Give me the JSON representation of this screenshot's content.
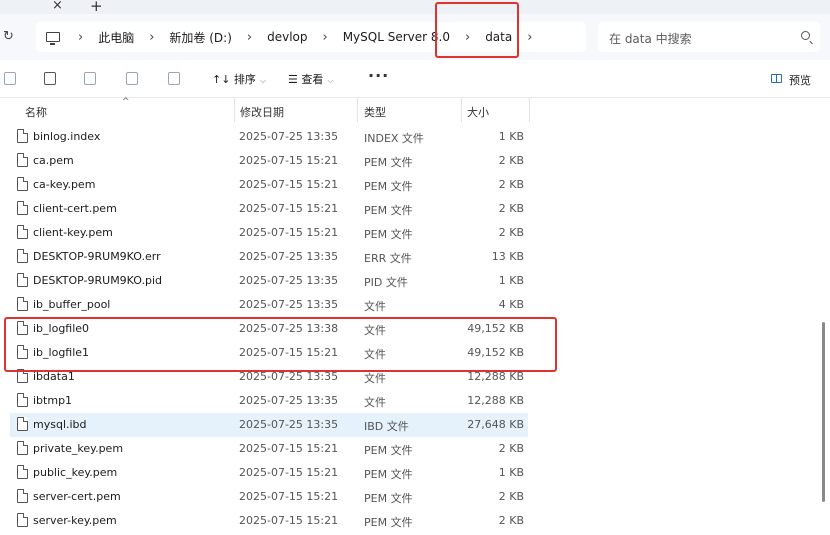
{
  "window": {
    "tab_close": "×",
    "tab_new": "+"
  },
  "address": {
    "refresh_icon": "refresh-icon",
    "crumbs": [
      "此电脑",
      "新加卷 (D:)",
      "devlop",
      "MySQL Server 8.0",
      "data"
    ],
    "separator": "›"
  },
  "search": {
    "placeholder": "在 data 中搜索"
  },
  "toolbar": {
    "sort_label": "↑↓ 排序",
    "view_label": "☰ 查看",
    "more_label": "···",
    "preview_label": "预览"
  },
  "columns": {
    "name": "名称",
    "date": "修改日期",
    "type": "类型",
    "size": "大小",
    "sort_caret": "^"
  },
  "files": [
    {
      "name": "binlog.index",
      "date": "2025-07-25 13:35",
      "type": "INDEX 文件",
      "size": "1 KB"
    },
    {
      "name": "ca.pem",
      "date": "2025-07-15 15:21",
      "type": "PEM 文件",
      "size": "2 KB"
    },
    {
      "name": "ca-key.pem",
      "date": "2025-07-15 15:21",
      "type": "PEM 文件",
      "size": "2 KB"
    },
    {
      "name": "client-cert.pem",
      "date": "2025-07-15 15:21",
      "type": "PEM 文件",
      "size": "2 KB"
    },
    {
      "name": "client-key.pem",
      "date": "2025-07-15 15:21",
      "type": "PEM 文件",
      "size": "2 KB"
    },
    {
      "name": "DESKTOP-9RUM9KO.err",
      "date": "2025-07-25 13:35",
      "type": "ERR 文件",
      "size": "13 KB"
    },
    {
      "name": "DESKTOP-9RUM9KO.pid",
      "date": "2025-07-25 13:35",
      "type": "PID 文件",
      "size": "1 KB"
    },
    {
      "name": "ib_buffer_pool",
      "date": "2025-07-25 13:35",
      "type": "文件",
      "size": "4 KB"
    },
    {
      "name": "ib_logfile0",
      "date": "2025-07-25 13:38",
      "type": "文件",
      "size": "49,152 KB"
    },
    {
      "name": "ib_logfile1",
      "date": "2025-07-15 15:21",
      "type": "文件",
      "size": "49,152 KB"
    },
    {
      "name": "ibdata1",
      "date": "2025-07-25 13:35",
      "type": "文件",
      "size": "12,288 KB"
    },
    {
      "name": "ibtmp1",
      "date": "2025-07-25 13:35",
      "type": "文件",
      "size": "12,288 KB"
    },
    {
      "name": "mysql.ibd",
      "date": "2025-07-25 13:35",
      "type": "IBD 文件",
      "size": "27,648 KB",
      "selected": true
    },
    {
      "name": "private_key.pem",
      "date": "2025-07-15 15:21",
      "type": "PEM 文件",
      "size": "2 KB"
    },
    {
      "name": "public_key.pem",
      "date": "2025-07-15 15:21",
      "type": "PEM 文件",
      "size": "1 KB"
    },
    {
      "name": "server-cert.pem",
      "date": "2025-07-15 15:21",
      "type": "PEM 文件",
      "size": "2 KB"
    },
    {
      "name": "server-key.pem",
      "date": "2025-07-15 15:21",
      "type": "PEM 文件",
      "size": "2 KB"
    }
  ],
  "colors": {
    "highlight": "#e0332d",
    "selected_row": "#e5f1fb",
    "accent": "#2a6bb5"
  }
}
